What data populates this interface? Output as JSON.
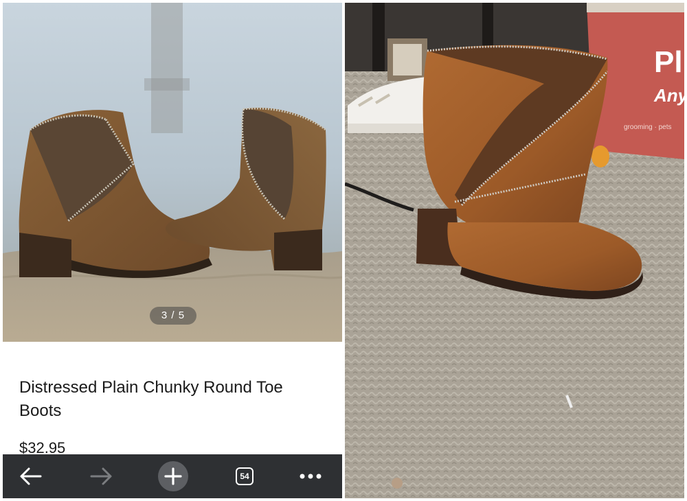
{
  "product": {
    "image_counter": "3 / 5",
    "title": "Distressed Plain Chunky Round Toe Boots",
    "price": "$32.95"
  },
  "browser_toolbar": {
    "tabs_count": "54",
    "icons": [
      "back-arrow-icon",
      "forward-arrow-icon",
      "new-tab-plus-icon",
      "tabs-count-icon",
      "more-options-icon"
    ]
  },
  "customer_photo": {
    "box_text_large": "Pl",
    "box_text_medium": "Any",
    "box_text_small": "grooming · pets"
  },
  "colors": {
    "toolbar_bg": "#2e3033",
    "boot_brown": "#9a5a2a",
    "carpet": "#aaa397"
  }
}
